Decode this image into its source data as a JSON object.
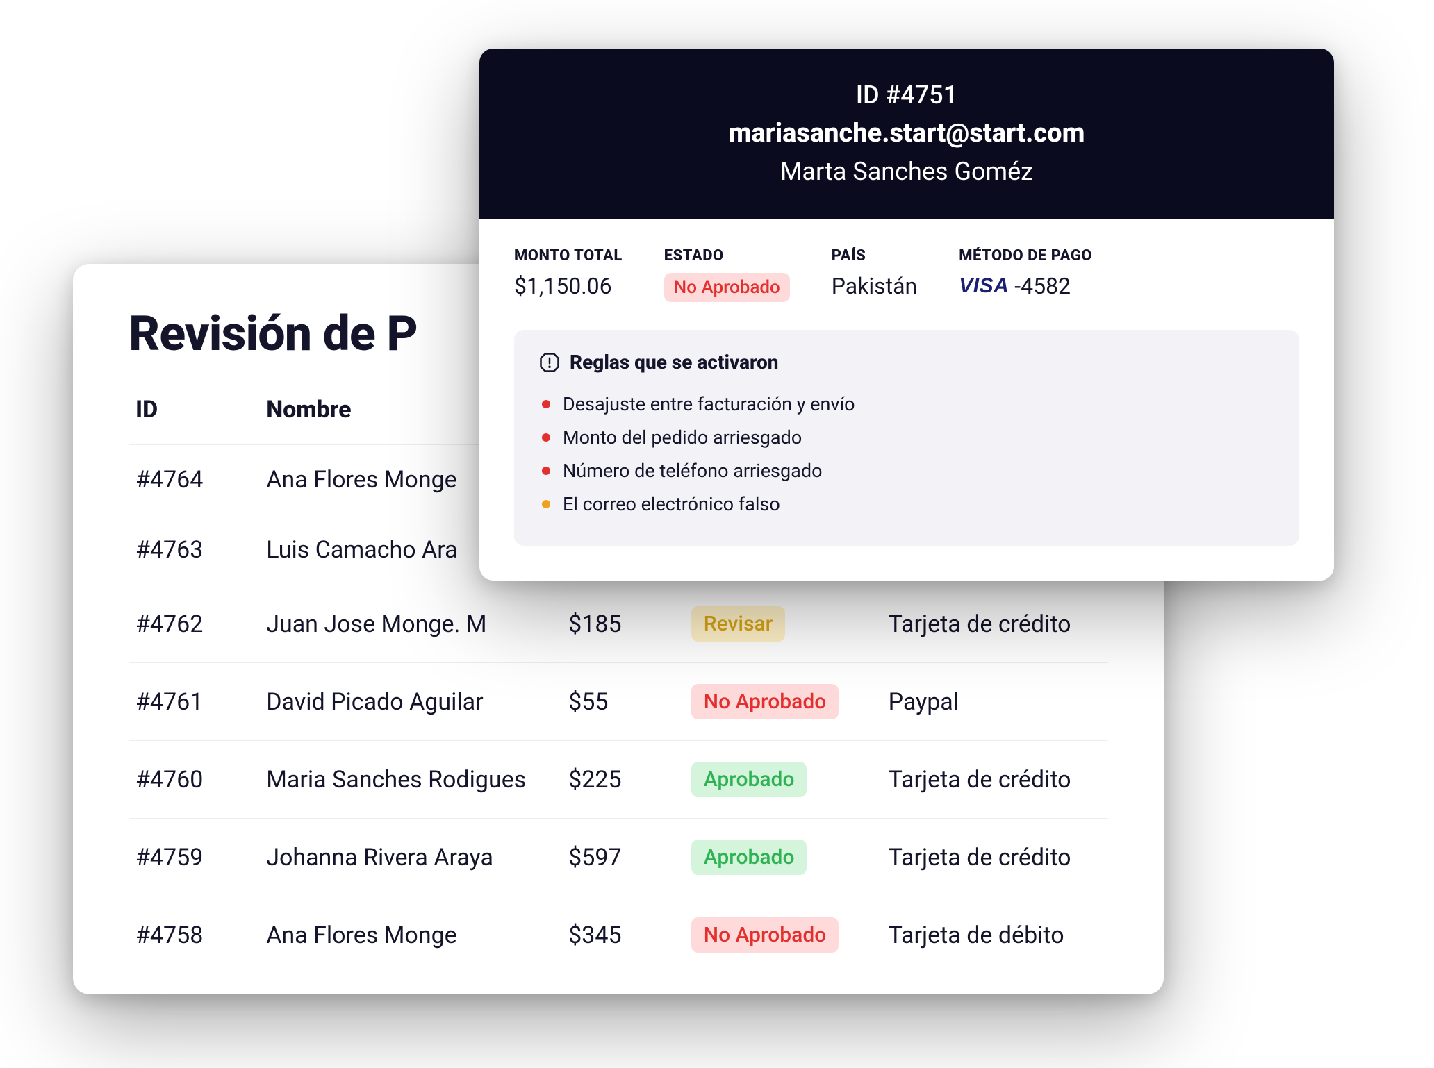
{
  "table": {
    "title": "Revisión de P",
    "headers": {
      "id": "ID",
      "name": "Nombre"
    },
    "rows": [
      {
        "id": "#4764",
        "name": "Ana Flores Monge"
      },
      {
        "id": "#4763",
        "name": "Luis Camacho Ara"
      },
      {
        "id": "#4762",
        "name": "Juan Jose Monge. M",
        "amount": "$185",
        "status": "Revisar",
        "status_kind": "review",
        "payment": "Tarjeta de crédito"
      },
      {
        "id": "#4761",
        "name": "David Picado Aguilar",
        "amount": "$55",
        "status": "No Aprobado",
        "status_kind": "notapproved",
        "payment": "Paypal"
      },
      {
        "id": "#4760",
        "name": "Maria Sanches Rodigues",
        "amount": "$225",
        "status": "Aprobado",
        "status_kind": "approved",
        "payment": "Tarjeta de crédito"
      },
      {
        "id": "#4759",
        "name": "Johanna Rivera Araya",
        "amount": "$597",
        "status": "Aprobado",
        "status_kind": "approved",
        "payment": "Tarjeta de crédito"
      },
      {
        "id": "#4758",
        "name": "Ana Flores Monge",
        "amount": "$345",
        "status": "No Aprobado",
        "status_kind": "notapproved",
        "payment": "Tarjeta de débito"
      }
    ]
  },
  "detail": {
    "header": {
      "id_line": "ID #4751",
      "email": "mariasanche.start@start.com",
      "name": "Marta Sanches Goméz"
    },
    "metrics": {
      "total_label": "MONTO TOTAL",
      "total_value": "$1,150.06",
      "status_label": "ESTADO",
      "status_value": "No Aprobado",
      "status_kind": "notapproved",
      "country_label": "PAÍS",
      "country_value": "Pakistán",
      "payment_label": "MÉTODO DE PAGO",
      "payment_brand": "VISA",
      "payment_suffix": "-4582"
    },
    "rules": {
      "title": "Reglas que se activaron",
      "items": [
        {
          "text": "Desajuste entre facturación y envío",
          "color": "red"
        },
        {
          "text": "Monto del pedido arriesgado",
          "color": "red"
        },
        {
          "text": "Número de teléfono arriesgado",
          "color": "red"
        },
        {
          "text": "El correo electrónico falso",
          "color": "orange"
        }
      ]
    }
  }
}
